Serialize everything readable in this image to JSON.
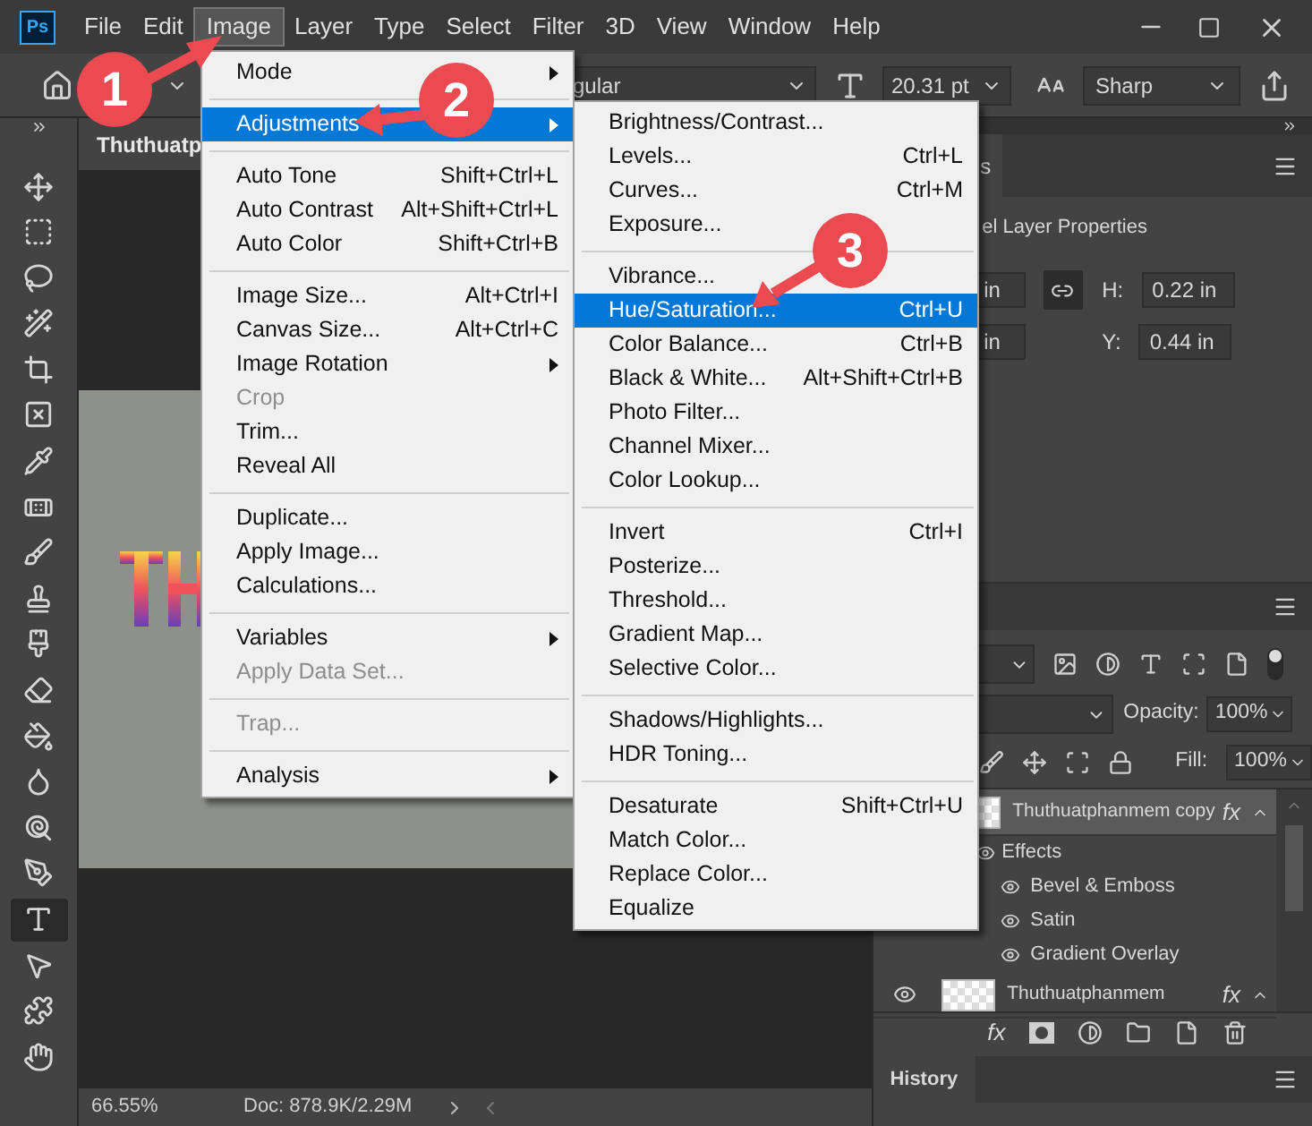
{
  "app": {
    "logo": "Ps"
  },
  "menu_bar": [
    {
      "label": "File",
      "selected": false
    },
    {
      "label": "Edit",
      "selected": false
    },
    {
      "label": "Image",
      "selected": true
    },
    {
      "label": "Layer",
      "selected": false
    },
    {
      "label": "Type",
      "selected": false
    },
    {
      "label": "Select",
      "selected": false
    },
    {
      "label": "Filter",
      "selected": false
    },
    {
      "label": "3D",
      "selected": false
    },
    {
      "label": "View",
      "selected": false
    },
    {
      "label": "Window",
      "selected": false
    },
    {
      "label": "Help",
      "selected": false
    }
  ],
  "options_bar": {
    "font_style": "gular",
    "font_size": "20.31 pt",
    "anti_alias": "Sharp"
  },
  "document_tab": "Thuthuatp",
  "tools": [
    {
      "kind": "move",
      "selected": false
    },
    {
      "kind": "marquee",
      "selected": false
    },
    {
      "kind": "lasso",
      "selected": false
    },
    {
      "kind": "wand",
      "selected": false
    },
    {
      "kind": "crop",
      "selected": false
    },
    {
      "kind": "frame",
      "selected": false
    },
    {
      "kind": "eyedropper",
      "selected": false
    },
    {
      "kind": "healing",
      "selected": false
    },
    {
      "kind": "brush",
      "selected": false
    },
    {
      "kind": "stamp",
      "selected": false
    },
    {
      "kind": "historybrush",
      "selected": false
    },
    {
      "kind": "eraser",
      "selected": false
    },
    {
      "kind": "bucket",
      "selected": false
    },
    {
      "kind": "blur",
      "selected": false
    },
    {
      "kind": "dodge",
      "selected": false
    },
    {
      "kind": "pen",
      "selected": false
    },
    {
      "kind": "type",
      "selected": true
    },
    {
      "kind": "pointer",
      "selected": false
    },
    {
      "kind": "shape",
      "selected": false
    },
    {
      "kind": "hand",
      "selected": false
    }
  ],
  "status_bar": {
    "zoom": "66.55%",
    "doc": "Doc: 878.9K/2.29M"
  },
  "properties_panel": {
    "tab": "s",
    "title": "el Layer Properties",
    "w_value": "in",
    "h_label": "H:",
    "h_value": "0.22 in",
    "x_value": "in",
    "y_label": "Y:",
    "y_value": "0.44 in"
  },
  "layers_panel": {
    "opacity_label": "Opacity:",
    "opacity": "100%",
    "fill_label": "Fill:",
    "fill": "100%",
    "bottom_fx": "fx",
    "layers": [
      {
        "name": "Thuthuatphanmem copy",
        "selected": true,
        "fx": "fx",
        "effects_label": "Effects",
        "effects": [
          "Bevel & Emboss",
          "Satin",
          "Gradient Overlay"
        ]
      },
      {
        "name": "Thuthuatphanmem",
        "selected": false,
        "fx": "fx"
      }
    ]
  },
  "history_tab": "History",
  "image_menu": [
    {
      "kind": "item",
      "label": "Mode",
      "submenu": true,
      "selected": false,
      "disabled": false
    },
    {
      "kind": "separator"
    },
    {
      "kind": "item",
      "label": "Adjustments",
      "submenu": true,
      "selected": true,
      "disabled": false
    },
    {
      "kind": "separator"
    },
    {
      "kind": "item",
      "label": "Auto Tone",
      "shortcut": "Shift+Ctrl+L",
      "selected": false,
      "disabled": false
    },
    {
      "kind": "item",
      "label": "Auto Contrast",
      "shortcut": "Alt+Shift+Ctrl+L",
      "selected": false,
      "disabled": false
    },
    {
      "kind": "item",
      "label": "Auto Color",
      "shortcut": "Shift+Ctrl+B",
      "selected": false,
      "disabled": false
    },
    {
      "kind": "separator"
    },
    {
      "kind": "item",
      "label": "Image Size...",
      "shortcut": "Alt+Ctrl+I",
      "selected": false,
      "disabled": false
    },
    {
      "kind": "item",
      "label": "Canvas Size...",
      "shortcut": "Alt+Ctrl+C",
      "selected": false,
      "disabled": false
    },
    {
      "kind": "item",
      "label": "Image Rotation",
      "submenu": true,
      "selected": false,
      "disabled": false
    },
    {
      "kind": "item",
      "label": "Crop",
      "selected": false,
      "disabled": true
    },
    {
      "kind": "item",
      "label": "Trim...",
      "selected": false,
      "disabled": false
    },
    {
      "kind": "item",
      "label": "Reveal All",
      "selected": false,
      "disabled": false
    },
    {
      "kind": "separator"
    },
    {
      "kind": "item",
      "label": "Duplicate...",
      "selected": false,
      "disabled": false
    },
    {
      "kind": "item",
      "label": "Apply Image...",
      "selected": false,
      "disabled": false
    },
    {
      "kind": "item",
      "label": "Calculations...",
      "selected": false,
      "disabled": false
    },
    {
      "kind": "separator"
    },
    {
      "kind": "item",
      "label": "Variables",
      "submenu": true,
      "selected": false,
      "disabled": false
    },
    {
      "kind": "item",
      "label": "Apply Data Set...",
      "selected": false,
      "disabled": true
    },
    {
      "kind": "separator"
    },
    {
      "kind": "item",
      "label": "Trap...",
      "selected": false,
      "disabled": true
    },
    {
      "kind": "separator"
    },
    {
      "kind": "item",
      "label": "Analysis",
      "submenu": true,
      "selected": false,
      "disabled": false
    }
  ],
  "adjustments_menu": [
    {
      "kind": "item",
      "label": "Brightness/Contrast...",
      "selected": false,
      "disabled": false
    },
    {
      "kind": "item",
      "label": "Levels...",
      "shortcut": "Ctrl+L",
      "selected": false,
      "disabled": false
    },
    {
      "kind": "item",
      "label": "Curves...",
      "shortcut": "Ctrl+M",
      "selected": false,
      "disabled": false
    },
    {
      "kind": "item",
      "label": "Exposure...",
      "selected": false,
      "disabled": false
    },
    {
      "kind": "separator"
    },
    {
      "kind": "item",
      "label": "Vibrance...",
      "selected": false,
      "disabled": false
    },
    {
      "kind": "item",
      "label": "Hue/Saturation...",
      "shortcut": "Ctrl+U",
      "selected": true,
      "disabled": false
    },
    {
      "kind": "item",
      "label": "Color Balance...",
      "shortcut": "Ctrl+B",
      "selected": false,
      "disabled": false
    },
    {
      "kind": "item",
      "label": "Black & White...",
      "shortcut": "Alt+Shift+Ctrl+B",
      "selected": false,
      "disabled": false
    },
    {
      "kind": "item",
      "label": "Photo Filter...",
      "selected": false,
      "disabled": false
    },
    {
      "kind": "item",
      "label": "Channel Mixer...",
      "selected": false,
      "disabled": false
    },
    {
      "kind": "item",
      "label": "Color Lookup...",
      "selected": false,
      "disabled": false
    },
    {
      "kind": "separator"
    },
    {
      "kind": "item",
      "label": "Invert",
      "shortcut": "Ctrl+I",
      "selected": false,
      "disabled": false
    },
    {
      "kind": "item",
      "label": "Posterize...",
      "selected": false,
      "disabled": false
    },
    {
      "kind": "item",
      "label": "Threshold...",
      "selected": false,
      "disabled": false
    },
    {
      "kind": "item",
      "label": "Gradient Map...",
      "selected": false,
      "disabled": false
    },
    {
      "kind": "item",
      "label": "Selective Color...",
      "selected": false,
      "disabled": false
    },
    {
      "kind": "separator"
    },
    {
      "kind": "item",
      "label": "Shadows/Highlights...",
      "selected": false,
      "disabled": false
    },
    {
      "kind": "item",
      "label": "HDR Toning...",
      "selected": false,
      "disabled": false
    },
    {
      "kind": "separator"
    },
    {
      "kind": "item",
      "label": "Desaturate",
      "shortcut": "Shift+Ctrl+U",
      "selected": false,
      "disabled": false
    },
    {
      "kind": "item",
      "label": "Match Color...",
      "selected": false,
      "disabled": false
    },
    {
      "kind": "item",
      "label": "Replace Color...",
      "selected": false,
      "disabled": false
    },
    {
      "kind": "item",
      "label": "Equalize",
      "selected": false,
      "disabled": false
    }
  ],
  "callouts": [
    {
      "label": "1"
    },
    {
      "label": "2"
    },
    {
      "label": "3"
    }
  ]
}
